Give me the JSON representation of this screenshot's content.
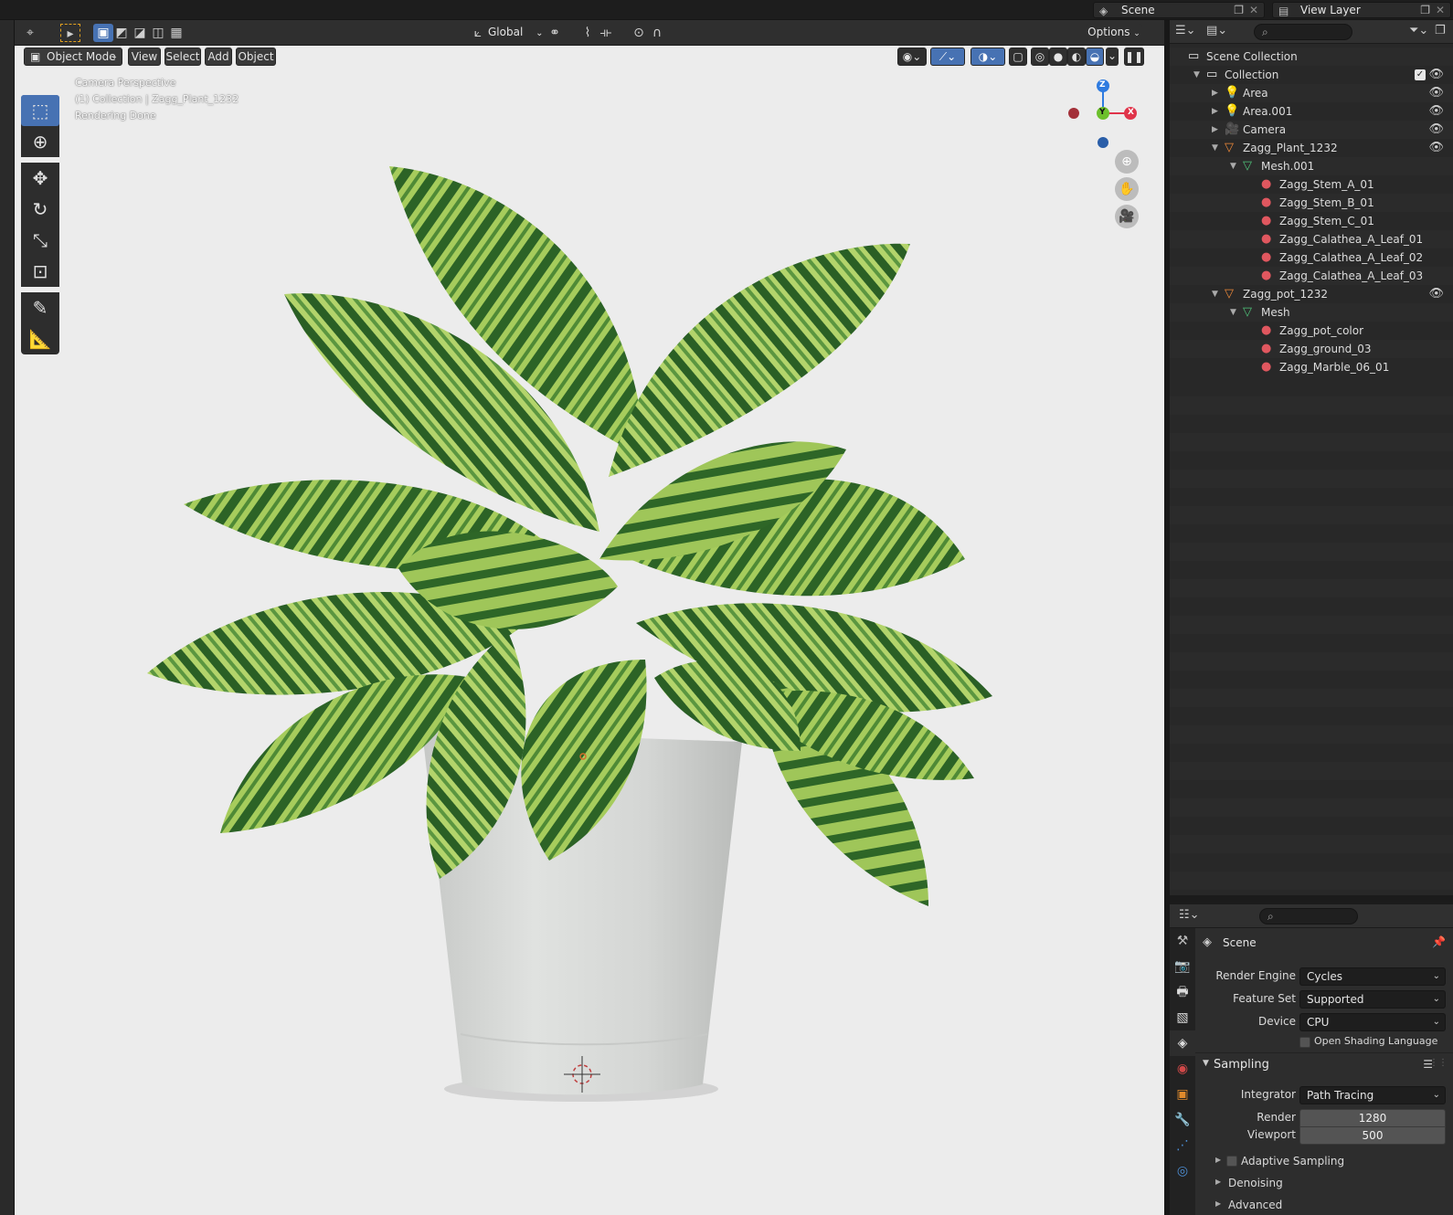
{
  "topbar": {
    "scene_label": "Scene",
    "view_layer_label": "View Layer"
  },
  "viewport": {
    "header": {
      "transform_orientation": "Global",
      "options_label": "Options",
      "mode_label": "Object Mode",
      "menu": [
        "View",
        "Select",
        "Add",
        "Object"
      ]
    },
    "overlay_text": [
      "Camera Perspective",
      "(1) Collection | Zagg_Plant_1232",
      "Rendering Done"
    ],
    "gizmo_axes": {
      "z": "Z",
      "y": "Y",
      "x": "X"
    },
    "colors": {
      "bg": "#ececec",
      "leaf_dark": "#2f6a2a",
      "leaf_light": "#b9d86a",
      "pot": "#d9dbd9"
    }
  },
  "outliner": {
    "search_placeholder": "",
    "rows": [
      {
        "label": "Scene Collection",
        "depth": 0,
        "icon": "collection-icon",
        "expanded": null
      },
      {
        "label": "Collection",
        "depth": 1,
        "icon": "collection-icon",
        "expanded": true
      },
      {
        "label": "Area",
        "depth": 2,
        "icon": "light-icon",
        "expanded": false
      },
      {
        "label": "Area.001",
        "depth": 2,
        "icon": "light-icon",
        "expanded": false
      },
      {
        "label": "Camera",
        "depth": 2,
        "icon": "camera-icon",
        "expanded": false
      },
      {
        "label": "Zagg_Plant_1232",
        "depth": 2,
        "icon": "mesh-object-icon",
        "expanded": true
      },
      {
        "label": "Mesh.001",
        "depth": 3,
        "icon": "mesh-data-icon",
        "expanded": true
      },
      {
        "label": "Zagg_Stem_A_01",
        "depth": 4,
        "icon": "material-icon",
        "expanded": null
      },
      {
        "label": "Zagg_Stem_B_01",
        "depth": 4,
        "icon": "material-icon",
        "expanded": null
      },
      {
        "label": "Zagg_Stem_C_01",
        "depth": 4,
        "icon": "material-icon",
        "expanded": null
      },
      {
        "label": "Zagg_Calathea_A_Leaf_01",
        "depth": 4,
        "icon": "material-icon",
        "expanded": null
      },
      {
        "label": "Zagg_Calathea_A_Leaf_02",
        "depth": 4,
        "icon": "material-icon",
        "expanded": null
      },
      {
        "label": "Zagg_Calathea_A_Leaf_03",
        "depth": 4,
        "icon": "material-icon",
        "expanded": null
      },
      {
        "label": "Zagg_pot_1232",
        "depth": 2,
        "icon": "mesh-object-icon",
        "expanded": true
      },
      {
        "label": "Mesh",
        "depth": 3,
        "icon": "mesh-data-icon",
        "expanded": true
      },
      {
        "label": "Zagg_pot_color",
        "depth": 4,
        "icon": "material-icon",
        "expanded": null
      },
      {
        "label": "Zagg_ground_03",
        "depth": 4,
        "icon": "material-icon",
        "expanded": null
      },
      {
        "label": "Zagg_Marble_06_01",
        "depth": 4,
        "icon": "material-icon",
        "expanded": null
      }
    ]
  },
  "properties": {
    "context_title": "Scene",
    "render_engine_label": "Render Engine",
    "render_engine_value": "Cycles",
    "feature_set_label": "Feature Set",
    "feature_set_value": "Supported",
    "device_label": "Device",
    "device_value": "CPU",
    "osl_label": "Open Shading Language",
    "sampling_label": "Sampling",
    "integrator_label": "Integrator",
    "integrator_value": "Path Tracing",
    "render_label": "Render",
    "render_value": "1280",
    "viewport_label": "Viewport",
    "viewport_value": "500",
    "adaptive_label": "Adaptive Sampling",
    "denoising_label": "Denoising",
    "advanced_label": "Advanced"
  }
}
